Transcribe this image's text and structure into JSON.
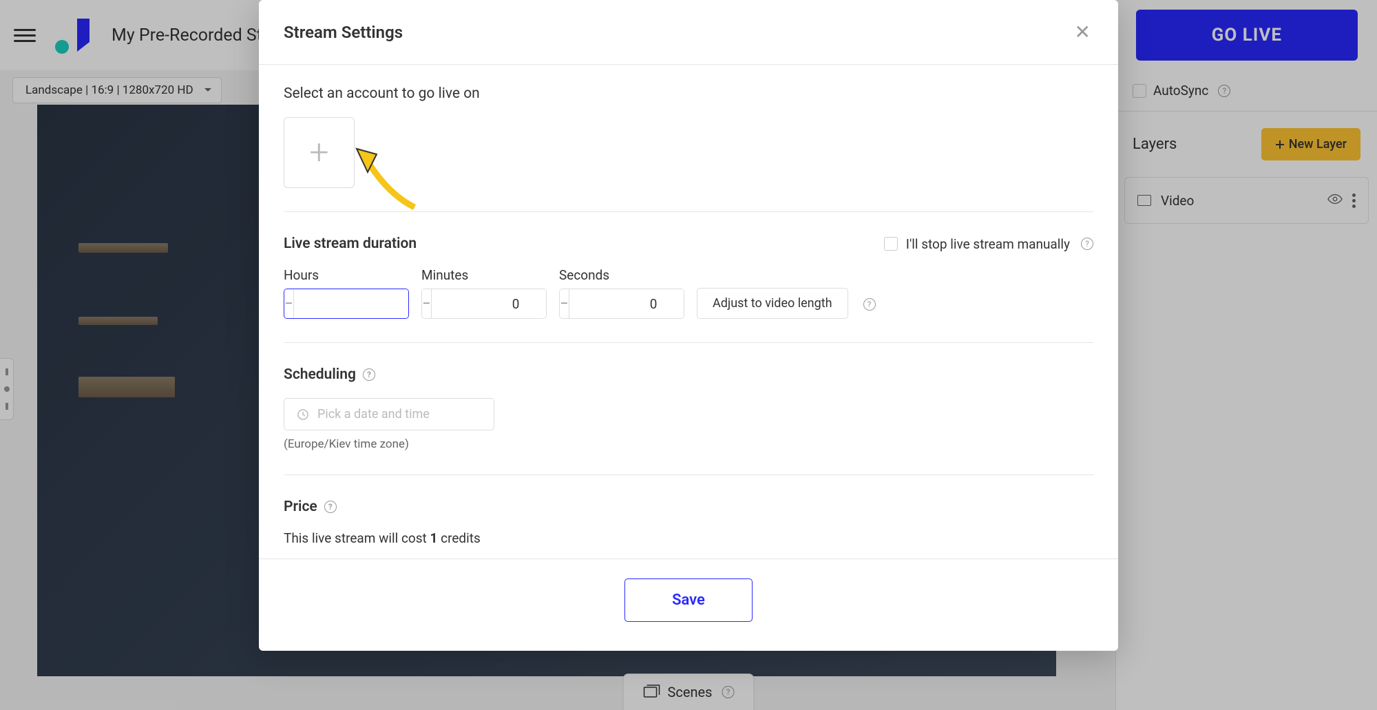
{
  "header": {
    "stream_title": "My Pre-Recorded Stream",
    "go_live_label": "GO LIVE",
    "format": "Landscape | 16:9 | 1280x720 HD"
  },
  "right_panel": {
    "autosync_label": "AutoSync",
    "layers_title": "Layers",
    "new_layer_label": "New Layer",
    "layers": [
      {
        "name": "Video"
      }
    ]
  },
  "scenes": {
    "label": "Scenes"
  },
  "modal": {
    "title": "Stream Settings",
    "account_section": "Select an account to go live on",
    "duration_section": "Live stream duration",
    "manual_stop_label": "I'll stop live stream manually",
    "hours_label": "Hours",
    "minutes_label": "Minutes",
    "seconds_label": "Seconds",
    "hours_value": "",
    "minutes_value": "0",
    "seconds_value": "0",
    "adjust_label": "Adjust to video length",
    "scheduling_label": "Scheduling",
    "date_placeholder": "Pick a date and time",
    "timezone_note": "(Europe/Kiev time zone)",
    "price_label": "Price",
    "price_text_before": "This live stream will cost ",
    "price_credits": "1",
    "price_text_after": " credits",
    "save_label": "Save"
  }
}
